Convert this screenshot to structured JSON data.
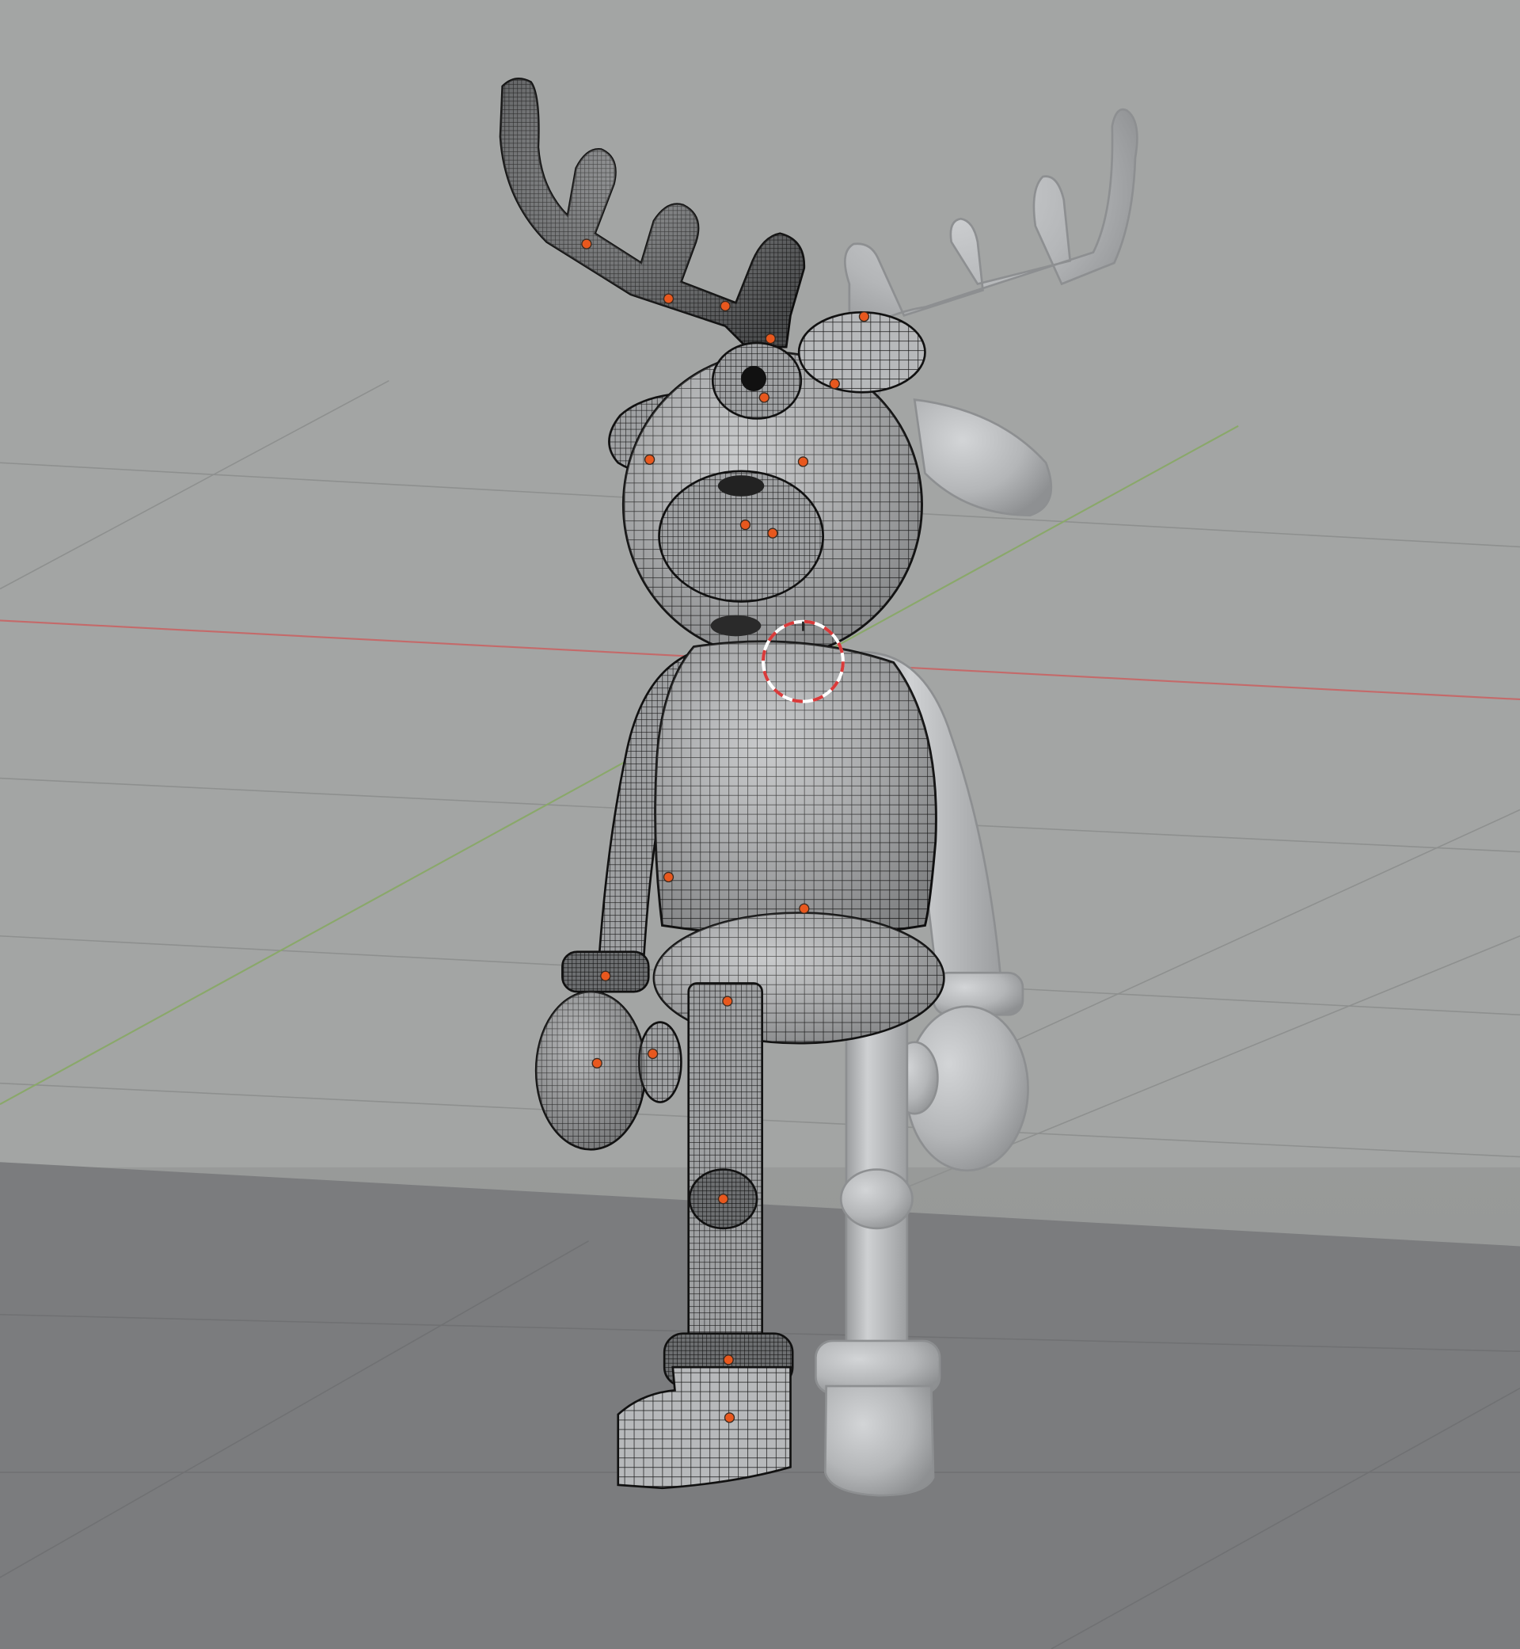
{
  "viewport": {
    "mode": "3D viewport",
    "view": "perspective",
    "shading_selected": "wireframe",
    "shading_unselected": "solid",
    "model": "reindeer",
    "origin_point_color": "#e8581e",
    "x_axis_color": "#c46a6a",
    "y_axis_color": "#8aa86a",
    "grid_color": "#8e908f",
    "floor_color": "#7b7c7e",
    "backdrop_color": "#a3a5a4",
    "solid_surface_color": "#b4b6b8",
    "wire_color": "#1a1a1a"
  }
}
